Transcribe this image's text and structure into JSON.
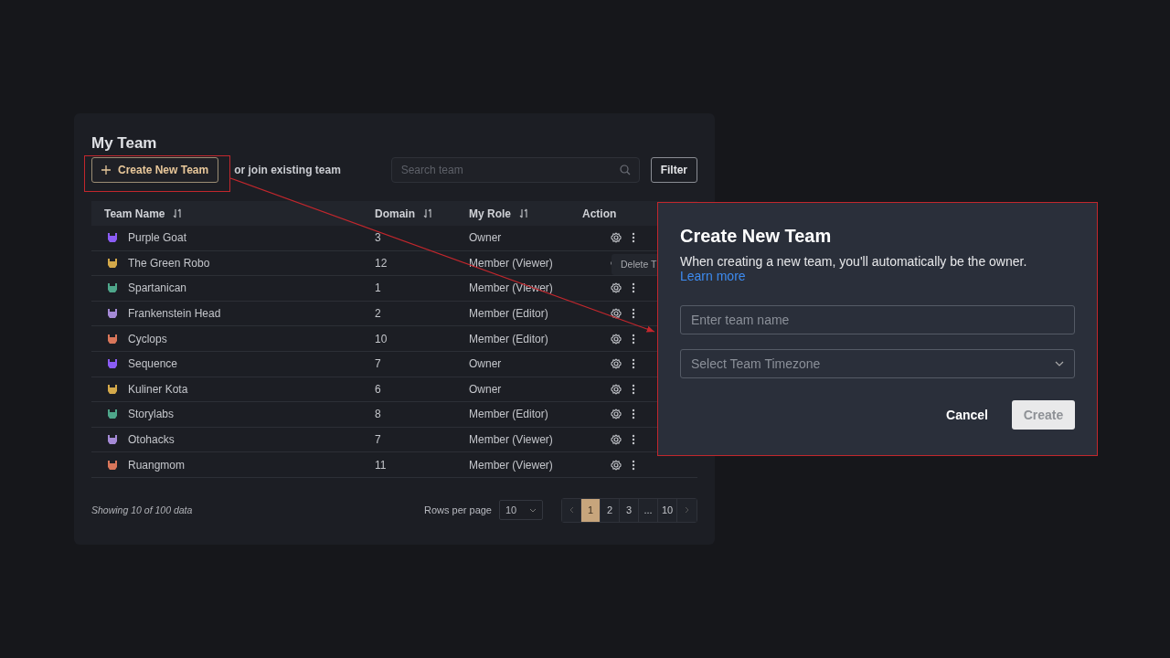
{
  "panel": {
    "title": "My Team",
    "create_button": "Create New Team",
    "join_text": "or join existing team",
    "search": {
      "placeholder": "Search team"
    },
    "filter_button": "Filter"
  },
  "table": {
    "columns": [
      {
        "label": "Team Name",
        "sortable": true
      },
      {
        "label": "Domain",
        "sortable": true
      },
      {
        "label": "My Role",
        "sortable": true
      },
      {
        "label": "Action",
        "sortable": false
      }
    ],
    "rows": [
      {
        "name": "Purple Goat",
        "color": "#8b5cf6",
        "domain": "3",
        "role": "Owner"
      },
      {
        "name": "The Green Robo",
        "color": "#d4a94a",
        "domain": "12",
        "role": "Member (Viewer)"
      },
      {
        "name": "Spartanican",
        "color": "#4ea68a",
        "domain": "1",
        "role": "Member (Viewer)"
      },
      {
        "name": "Frankenstein Head",
        "color": "#a58ad6",
        "domain": "2",
        "role": "Member (Editor)"
      },
      {
        "name": "Cyclops",
        "color": "#d9765a",
        "domain": "10",
        "role": "Member (Editor)"
      },
      {
        "name": "Sequence",
        "color": "#8b5cf6",
        "domain": "7",
        "role": "Owner"
      },
      {
        "name": "Kuliner Kota",
        "color": "#d4a94a",
        "domain": "6",
        "role": "Owner"
      },
      {
        "name": "Storylabs",
        "color": "#4ea68a",
        "domain": "8",
        "role": "Member (Editor)"
      },
      {
        "name": "Otohacks",
        "color": "#a58ad6",
        "domain": "7",
        "role": "Member (Viewer)"
      },
      {
        "name": "Ruangmom",
        "color": "#d9765a",
        "domain": "11",
        "role": "Member (Viewer)"
      }
    ],
    "tooltip": "Delete T"
  },
  "footer": {
    "showing": "Showing 10 of 100 data",
    "rows_per_page_label": "Rows per page",
    "rows_per_page": "10",
    "pages": [
      {
        "label": "1",
        "selected": true
      },
      {
        "label": "2",
        "selected": false
      },
      {
        "label": "3",
        "selected": false
      },
      {
        "label": "...",
        "selected": false
      },
      {
        "label": "10",
        "selected": false
      }
    ]
  },
  "dialog": {
    "title": "Create New Team",
    "text": "When creating a new team, you'll automatically be the owner.",
    "link": "Learn more",
    "name_field": {
      "placeholder": "Enter team name"
    },
    "timezone_select": {
      "placeholder": "Select Team Timezone"
    },
    "cancel_button": "Cancel",
    "create_button": "Create"
  }
}
